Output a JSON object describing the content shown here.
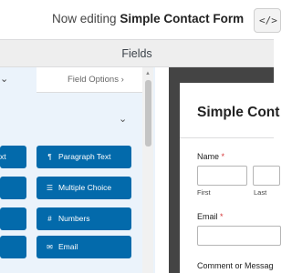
{
  "header": {
    "title_prefix": "Now editing",
    "form_name": "Simple Contact Form",
    "embed_label": "</>"
  },
  "fields_bar": {
    "label": "Fields"
  },
  "left_panel": {
    "tab_add_chevron": "⌄",
    "tab_field_options": "Field Options  ›",
    "section_chevron": "⌄",
    "buttons_left": [
      {
        "label": "xt"
      },
      {
        "label": ""
      },
      {
        "label": ""
      },
      {
        "label": ""
      }
    ],
    "buttons_right": [
      {
        "icon": "paragraph-icon",
        "glyph": "¶",
        "label": "Paragraph Text"
      },
      {
        "icon": "list-icon",
        "glyph": "☰",
        "label": "Multiple Choice"
      },
      {
        "icon": "hash-icon",
        "glyph": "#",
        "label": "Numbers"
      },
      {
        "icon": "envelope-icon",
        "glyph": "✉",
        "label": "Email"
      }
    ]
  },
  "preview": {
    "title": "Simple Cont",
    "name_label": "Name",
    "name_required": "*",
    "first_label": "First",
    "last_label": "Last",
    "email_label": "Email",
    "email_required": "*",
    "comment_label": "Comment or Messag"
  }
}
